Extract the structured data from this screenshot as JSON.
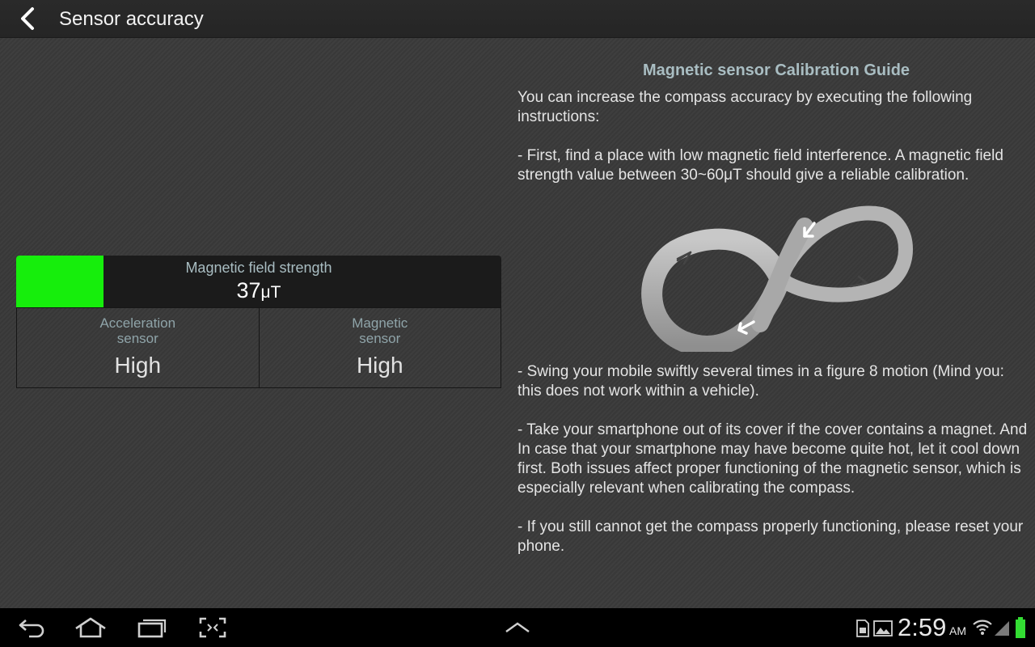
{
  "header": {
    "title": "Sensor accuracy"
  },
  "meter": {
    "label": "Magnetic field strength",
    "value": "37",
    "unit": "μT",
    "level_fraction": 0.18,
    "fill_color": "#16ee0c"
  },
  "sensors": [
    {
      "label": "Acceleration\nsensor",
      "value": "High"
    },
    {
      "label": "Magnetic\nsensor",
      "value": "High"
    }
  ],
  "guide": {
    "title": "Magnetic sensor Calibration Guide",
    "paragraphs": [
      "You can increase the compass accuracy by executing the following instructions:",
      "- First, find a place with low magnetic field interference. A magnetic field strength value between 30~60μT should give a reliable calibration.",
      "- Swing your mobile swiftly several times in a figure 8 motion (Mind you: this does not work within a vehicle).",
      "- Take your smartphone out of its cover if the cover contains a magnet. And In case that your smartphone may have become quite hot, let it cool down first. Both issues affect proper functioning of the magnetic sensor, which is especially relevant when calibrating the compass.",
      "- If you still cannot get the compass properly functioning, please reset your phone."
    ]
  },
  "status": {
    "time": "2:59",
    "ampm": "AM",
    "battery_color": "#33dd33"
  },
  "icons": {
    "back": "chevron-left-icon",
    "nav_back": "back-arrow-icon",
    "home": "home-icon",
    "recents": "recent-apps-icon",
    "screenshot": "screenshot-icon",
    "up": "chevron-up-icon",
    "sd": "sd-card-icon",
    "gallery": "image-icon",
    "wifi": "wifi-icon",
    "signal": "signal-icon",
    "battery": "battery-icon"
  }
}
